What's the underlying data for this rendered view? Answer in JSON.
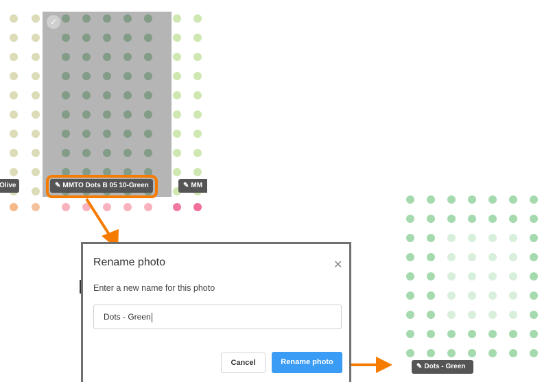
{
  "thumbnails": {
    "left_label": "Olive",
    "center_label": "MMTO Dots B 05 10-Green",
    "right_label": "MM",
    "edit_icon": "edit-icon",
    "check_icon": "check-icon"
  },
  "dialog": {
    "title": "Rename photo",
    "close_icon": "close-icon",
    "description": "Enter a new name for this photo",
    "input_value": "Dots - Green",
    "cancel_label": "Cancel",
    "rename_label": "Rename photo"
  },
  "result": {
    "label": "Dots - Green"
  },
  "colors": {
    "highlight": "#f57c00",
    "primary_button": "#3b9cf5",
    "chip": "#555555"
  }
}
